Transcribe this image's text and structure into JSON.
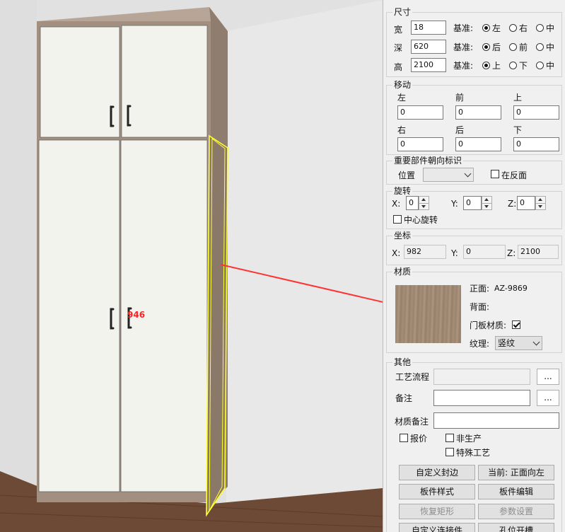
{
  "viewport": {
    "part_label": "946",
    "colors": {
      "wall": "#e3e3e3",
      "floor": "#6d4a35",
      "cabinet_body": "#a38f7f",
      "door": "#f3f3ed",
      "highlight": "#ffff33",
      "arrow": "#ff3333"
    }
  },
  "size": {
    "title": "尺寸",
    "basis": "基准:",
    "width": {
      "label": "宽",
      "value": "18",
      "options": [
        "左",
        "右",
        "中"
      ],
      "selected": 0
    },
    "depth": {
      "label": "深",
      "value": "620",
      "options": [
        "后",
        "前",
        "中"
      ],
      "selected": 0
    },
    "height": {
      "label": "高",
      "value": "2100",
      "options": [
        "上",
        "下",
        "中"
      ],
      "selected": 0
    }
  },
  "move": {
    "title": "移动",
    "left": {
      "label": "左",
      "value": "0"
    },
    "front": {
      "label": "前",
      "value": "0"
    },
    "up": {
      "label": "上",
      "value": "0"
    },
    "right": {
      "label": "右",
      "value": "0"
    },
    "back": {
      "label": "后",
      "value": "0"
    },
    "down": {
      "label": "下",
      "value": "0"
    }
  },
  "orientation": {
    "title": "重要部件朝向标识",
    "position_label": "位置",
    "position_value": "",
    "reverse_label": "在反面",
    "reverse_checked": false
  },
  "rotation": {
    "title": "旋转",
    "x": {
      "label": "X:",
      "value": "0"
    },
    "y": {
      "label": "Y:",
      "value": "0"
    },
    "z": {
      "label": "Z:",
      "value": "0"
    },
    "center_label": "中心旋转",
    "center_checked": false
  },
  "coords": {
    "title": "坐标",
    "x": {
      "label": "X:",
      "value": "982"
    },
    "y": {
      "label": "Y:",
      "value": "0"
    },
    "z": {
      "label": "Z:",
      "value": "2100"
    }
  },
  "material": {
    "title": "材质",
    "front_label": "正面:",
    "front_value": "AZ-9869",
    "back_label": "背面:",
    "back_value": "",
    "door_label": "门板材质:",
    "door_checked": true,
    "grain_label": "纹理:",
    "grain_value": "竖纹",
    "swatch_color": "#a08a73"
  },
  "other": {
    "title": "其他",
    "process_label": "工艺流程",
    "process_value": "",
    "remark_label": "备注",
    "remark_value": "",
    "material_remark_label": "材质备注",
    "material_remark_value": "",
    "browse": "...",
    "quote_label": "报价",
    "nonprod_label": "非生产",
    "special_label": "特殊工艺"
  },
  "buttons": {
    "custom_edge": "自定义封边",
    "current": "当前: 正面向左",
    "board_style": "板件样式",
    "board_edit": "板件编辑",
    "restore_rect": "恢复矩形",
    "param_settings": "参数设置",
    "custom_connector": "自定义连接件",
    "hole_slot": "孔位开槽"
  }
}
